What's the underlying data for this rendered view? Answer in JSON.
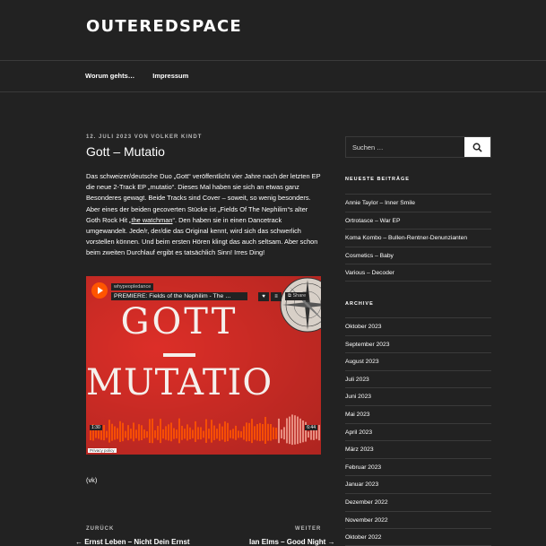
{
  "site": {
    "title": "OUTEREDSPACE"
  },
  "nav": {
    "items": [
      "Worum gehts…",
      "Impressum"
    ]
  },
  "post": {
    "meta": "12. JULI 2023 VON VOLKER KINDT",
    "title": "Gott – Mutatio",
    "text_a": "Das schweizer/deutsche Duo „Gott“ veröffentlicht vier Jahre nach der letzten EP die neue 2-Track EP „mutatio“. Dieses Mal haben sie sich an etwas ganz Besonderes gewagt. Beide Tracks sind Cover – soweit, so wenig besonders. Aber eines der beiden gecoverten Stücke ist „Fields Of The Nephilim“s alter Goth Rock Hit „",
    "text_link": "the watchman",
    "text_b": "“. Den haben sie in einen Dancetrack umgewandelt. Jede/r, der/die das Original kennt, wird sich das schwerlich vorstellen können. Und beim ersten Hören klingt das auch seltsam. Aber schon beim zweiten Durchlauf ergibt es tatsächlich Sinn! Irres Ding!",
    "signature": "(vk)"
  },
  "embed": {
    "user": "whypeopledance",
    "track": "PREMIERE: Fields of the Nephilim - The …",
    "share": "Share",
    "cover_line1": "GOTT",
    "cover_line2": "MUTATIO",
    "time_start": "1:30",
    "time_end": "6:44",
    "privacy": "Privacy policy"
  },
  "post_nav": {
    "prev_label": "ZURÜCK",
    "prev_title": "← Ernst Leben – Nicht Dein Ernst",
    "next_label": "WEITER",
    "next_title": "Ian Elms – Good Night →"
  },
  "search": {
    "placeholder": "Suchen …"
  },
  "recent": {
    "title": "NEUESTE BEITRÄGE",
    "items": [
      "Annie Taylor – Inner Smile",
      "Ortrotasce – War EP",
      "Koma Kombo – Bullen-Rentner-Denunzianten",
      "Cosmetics – Baby",
      "Various – Decoder"
    ]
  },
  "archive": {
    "title": "ARCHIVE",
    "items": [
      "Oktober 2023",
      "September 2023",
      "August 2023",
      "Juli 2023",
      "Juni 2023",
      "Mai 2023",
      "April 2023",
      "März 2023",
      "Februar 2023",
      "Januar 2023",
      "Dezember 2022",
      "November 2022",
      "Oktober 2022"
    ]
  },
  "colors": {
    "background": "#222222",
    "embed_red": "#e8312a",
    "soundcloud": "#ff5500"
  }
}
